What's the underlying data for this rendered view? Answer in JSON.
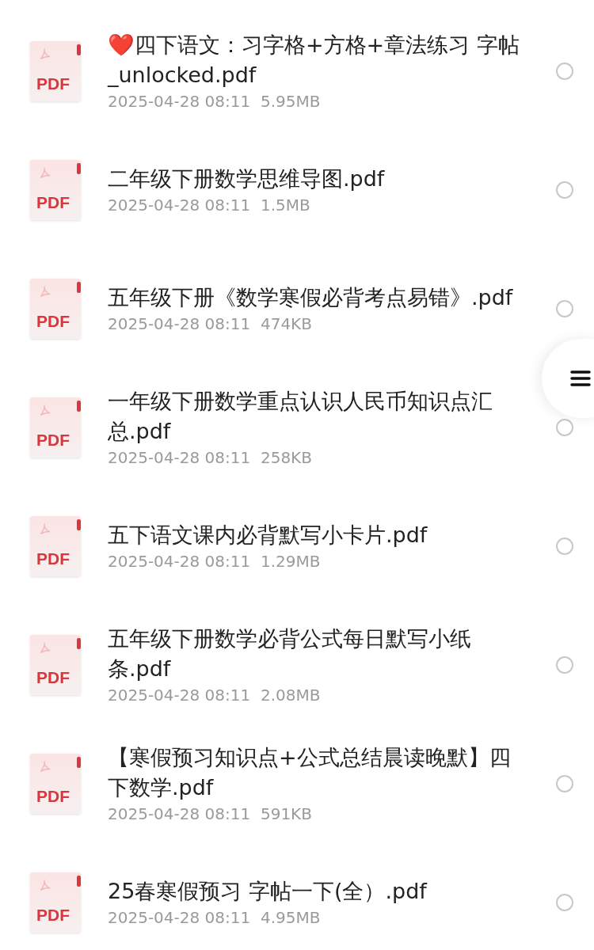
{
  "files": [
    {
      "icon_label": "PDF",
      "name": "❤️四下语文：习字格+方格+章法练习 字帖_unlocked.pdf",
      "meta": "2025-04-28 08:11  5.95MB",
      "selected": false
    },
    {
      "icon_label": "PDF",
      "name": "二年级下册数学思维导图.pdf",
      "meta": "2025-04-28 08:11  1.5MB",
      "selected": false
    },
    {
      "icon_label": "PDF",
      "name": "五年级下册《数学寒假必背考点易错》.pdf",
      "meta": "2025-04-28 08:11  474KB",
      "selected": false
    },
    {
      "icon_label": "PDF",
      "name": "一年级下册数学重点认识人民币知识点汇总.pdf",
      "meta": "2025-04-28 08:11  258KB",
      "selected": false
    },
    {
      "icon_label": "PDF",
      "name": "五下语文课内必背默写小卡片.pdf",
      "meta": "2025-04-28 08:11  1.29MB",
      "selected": false
    },
    {
      "icon_label": "PDF",
      "name": "五年级下册数学必背公式每日默写小纸条.pdf",
      "meta": "2025-04-28 08:11  2.08MB",
      "selected": false
    },
    {
      "icon_label": "PDF",
      "name": "【寒假预习知识点+公式总结晨读晚默】四下数学.pdf",
      "meta": "2025-04-28 08:11  591KB",
      "selected": false
    },
    {
      "icon_label": "PDF",
      "name": "25春寒假预习 字帖一下(全）.pdf",
      "meta": "2025-04-28 08:11  4.95MB",
      "selected": false
    }
  ]
}
